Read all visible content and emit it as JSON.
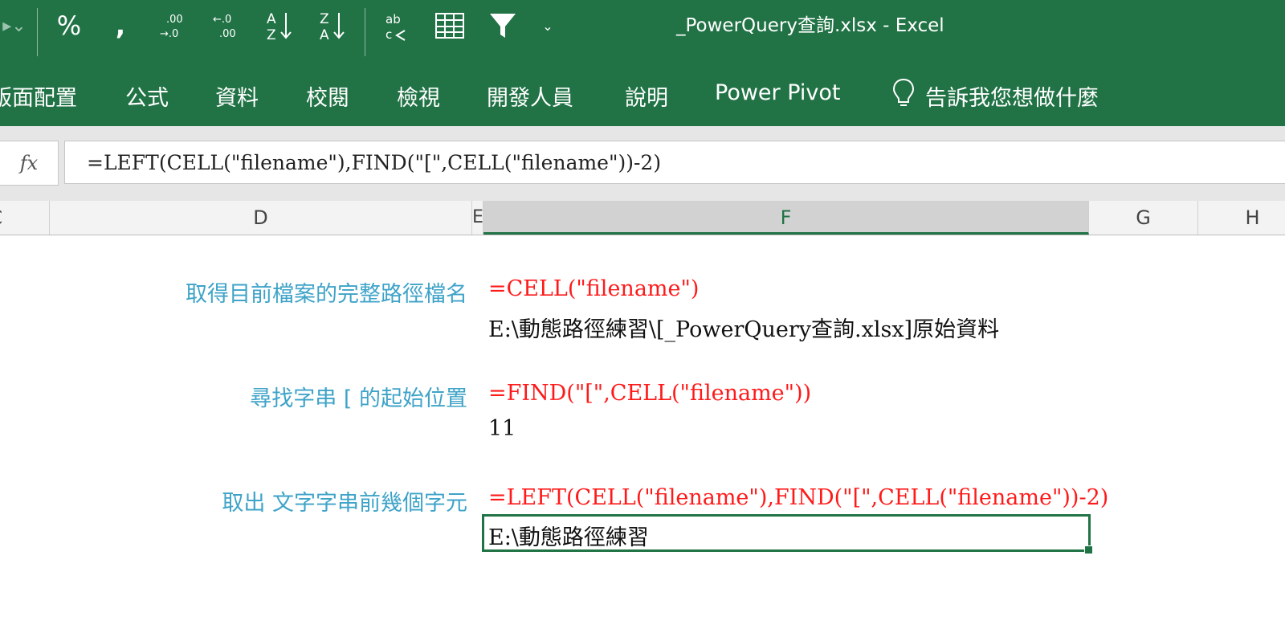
{
  "window": {
    "title": "_PowerQuery查詢.xlsx  -  Excel"
  },
  "quick_access": {
    "icons": [
      "redo-icon",
      "percent-icon",
      "comma-style-icon",
      "increase-decimal-icon",
      "decrease-decimal-icon",
      "sort-ascending-icon",
      "sort-descending-icon",
      "spelling-icon",
      "table-format-icon",
      "filter-icon",
      "customize-qat-icon"
    ]
  },
  "ribbon": {
    "tabs": [
      "版面配置",
      "公式",
      "資料",
      "校閱",
      "檢視",
      "開發人員",
      "說明",
      "Power Pivot"
    ],
    "tell_me": "告訴我您想做什麼"
  },
  "formula_bar": {
    "fx_label": "fx",
    "content": "=LEFT(CELL(\"filename\"),FIND(\"[\",CELL(\"filename\"))-2)"
  },
  "columns": [
    "C",
    "D",
    "E",
    "F",
    "G",
    "H"
  ],
  "rows": [
    {
      "label": "取得目前檔案的完整路徑檔名",
      "formula": "=CELL(\"filename\")",
      "value": "E:\\動態路徑練習\\[_PowerQuery查詢.xlsx]原始資料"
    },
    {
      "label": "尋找字串 [ 的起始位置",
      "formula": "=FIND(\"[\",CELL(\"filename\"))",
      "value": "11"
    },
    {
      "label": "取出 文字字串前幾個字元",
      "formula": "=LEFT(CELL(\"filename\"),FIND(\"[\",CELL(\"filename\"))-2)",
      "value": "E:\\動態路徑練習"
    }
  ],
  "colors": {
    "excel_green": "#217346",
    "label_blue": "#3ea3c8",
    "formula_red": "#ff1a1a"
  }
}
